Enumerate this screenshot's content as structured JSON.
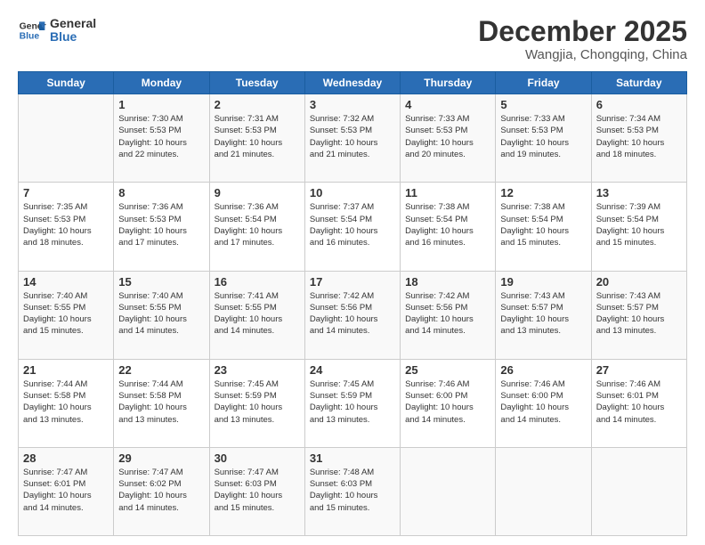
{
  "header": {
    "logo_general": "General",
    "logo_blue": "Blue",
    "month": "December 2025",
    "location": "Wangjia, Chongqing, China"
  },
  "days_of_week": [
    "Sunday",
    "Monday",
    "Tuesday",
    "Wednesday",
    "Thursday",
    "Friday",
    "Saturday"
  ],
  "weeks": [
    [
      {
        "day": "",
        "info": ""
      },
      {
        "day": "1",
        "info": "Sunrise: 7:30 AM\nSunset: 5:53 PM\nDaylight: 10 hours\nand 22 minutes."
      },
      {
        "day": "2",
        "info": "Sunrise: 7:31 AM\nSunset: 5:53 PM\nDaylight: 10 hours\nand 21 minutes."
      },
      {
        "day": "3",
        "info": "Sunrise: 7:32 AM\nSunset: 5:53 PM\nDaylight: 10 hours\nand 21 minutes."
      },
      {
        "day": "4",
        "info": "Sunrise: 7:33 AM\nSunset: 5:53 PM\nDaylight: 10 hours\nand 20 minutes."
      },
      {
        "day": "5",
        "info": "Sunrise: 7:33 AM\nSunset: 5:53 PM\nDaylight: 10 hours\nand 19 minutes."
      },
      {
        "day": "6",
        "info": "Sunrise: 7:34 AM\nSunset: 5:53 PM\nDaylight: 10 hours\nand 18 minutes."
      }
    ],
    [
      {
        "day": "7",
        "info": "Sunrise: 7:35 AM\nSunset: 5:53 PM\nDaylight: 10 hours\nand 18 minutes."
      },
      {
        "day": "8",
        "info": "Sunrise: 7:36 AM\nSunset: 5:53 PM\nDaylight: 10 hours\nand 17 minutes."
      },
      {
        "day": "9",
        "info": "Sunrise: 7:36 AM\nSunset: 5:54 PM\nDaylight: 10 hours\nand 17 minutes."
      },
      {
        "day": "10",
        "info": "Sunrise: 7:37 AM\nSunset: 5:54 PM\nDaylight: 10 hours\nand 16 minutes."
      },
      {
        "day": "11",
        "info": "Sunrise: 7:38 AM\nSunset: 5:54 PM\nDaylight: 10 hours\nand 16 minutes."
      },
      {
        "day": "12",
        "info": "Sunrise: 7:38 AM\nSunset: 5:54 PM\nDaylight: 10 hours\nand 15 minutes."
      },
      {
        "day": "13",
        "info": "Sunrise: 7:39 AM\nSunset: 5:54 PM\nDaylight: 10 hours\nand 15 minutes."
      }
    ],
    [
      {
        "day": "14",
        "info": "Sunrise: 7:40 AM\nSunset: 5:55 PM\nDaylight: 10 hours\nand 15 minutes."
      },
      {
        "day": "15",
        "info": "Sunrise: 7:40 AM\nSunset: 5:55 PM\nDaylight: 10 hours\nand 14 minutes."
      },
      {
        "day": "16",
        "info": "Sunrise: 7:41 AM\nSunset: 5:55 PM\nDaylight: 10 hours\nand 14 minutes."
      },
      {
        "day": "17",
        "info": "Sunrise: 7:42 AM\nSunset: 5:56 PM\nDaylight: 10 hours\nand 14 minutes."
      },
      {
        "day": "18",
        "info": "Sunrise: 7:42 AM\nSunset: 5:56 PM\nDaylight: 10 hours\nand 14 minutes."
      },
      {
        "day": "19",
        "info": "Sunrise: 7:43 AM\nSunset: 5:57 PM\nDaylight: 10 hours\nand 13 minutes."
      },
      {
        "day": "20",
        "info": "Sunrise: 7:43 AM\nSunset: 5:57 PM\nDaylight: 10 hours\nand 13 minutes."
      }
    ],
    [
      {
        "day": "21",
        "info": "Sunrise: 7:44 AM\nSunset: 5:58 PM\nDaylight: 10 hours\nand 13 minutes."
      },
      {
        "day": "22",
        "info": "Sunrise: 7:44 AM\nSunset: 5:58 PM\nDaylight: 10 hours\nand 13 minutes."
      },
      {
        "day": "23",
        "info": "Sunrise: 7:45 AM\nSunset: 5:59 PM\nDaylight: 10 hours\nand 13 minutes."
      },
      {
        "day": "24",
        "info": "Sunrise: 7:45 AM\nSunset: 5:59 PM\nDaylight: 10 hours\nand 13 minutes."
      },
      {
        "day": "25",
        "info": "Sunrise: 7:46 AM\nSunset: 6:00 PM\nDaylight: 10 hours\nand 14 minutes."
      },
      {
        "day": "26",
        "info": "Sunrise: 7:46 AM\nSunset: 6:00 PM\nDaylight: 10 hours\nand 14 minutes."
      },
      {
        "day": "27",
        "info": "Sunrise: 7:46 AM\nSunset: 6:01 PM\nDaylight: 10 hours\nand 14 minutes."
      }
    ],
    [
      {
        "day": "28",
        "info": "Sunrise: 7:47 AM\nSunset: 6:01 PM\nDaylight: 10 hours\nand 14 minutes."
      },
      {
        "day": "29",
        "info": "Sunrise: 7:47 AM\nSunset: 6:02 PM\nDaylight: 10 hours\nand 14 minutes."
      },
      {
        "day": "30",
        "info": "Sunrise: 7:47 AM\nSunset: 6:03 PM\nDaylight: 10 hours\nand 15 minutes."
      },
      {
        "day": "31",
        "info": "Sunrise: 7:48 AM\nSunset: 6:03 PM\nDaylight: 10 hours\nand 15 minutes."
      },
      {
        "day": "",
        "info": ""
      },
      {
        "day": "",
        "info": ""
      },
      {
        "day": "",
        "info": ""
      }
    ]
  ]
}
